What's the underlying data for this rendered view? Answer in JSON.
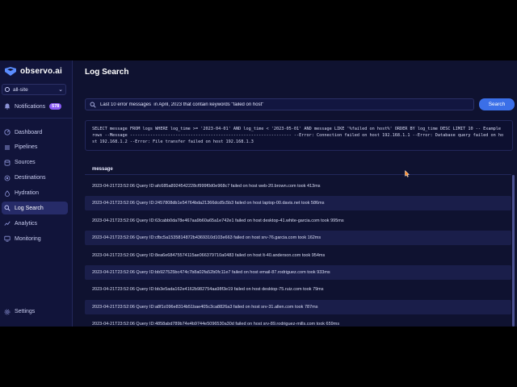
{
  "app": {
    "name": "observo.ai"
  },
  "site_selector": {
    "value": "all-site"
  },
  "notifications": {
    "label": "Notifications",
    "count": "578"
  },
  "nav": {
    "items": [
      {
        "label": "Dashboard",
        "icon": "dashboard-icon"
      },
      {
        "label": "Pipelines",
        "icon": "pipelines-icon"
      },
      {
        "label": "Sources",
        "icon": "sources-icon"
      },
      {
        "label": "Destinations",
        "icon": "destinations-icon"
      },
      {
        "label": "Hydration",
        "icon": "hydration-icon"
      },
      {
        "label": "Log Search",
        "icon": "search-icon",
        "active": true
      },
      {
        "label": "Analytics",
        "icon": "analytics-icon"
      },
      {
        "label": "Monitoring",
        "icon": "monitoring-icon"
      }
    ],
    "settings_label": "Settings"
  },
  "page": {
    "title": "Log Search"
  },
  "search": {
    "value": "Last 10 error messages  in April, 2023 that contain keywords \"failed on host\"",
    "button_label": "Search"
  },
  "query_text": "SELECT message FROM logs WHERE log_time >= '2023-04-01' AND log_time < '2023-05-01' AND message LIKE '%failed on host%' ORDER BY log_time DESC LIMIT 10 -- Example rows --Message ---------------------------------------------------------------- --Error: Connection failed on host 192.168.1.1 --Error: Database query failed on host 192.168.1.2 --Error: File transfer failed on host 192.168.1.3",
  "table": {
    "column": "message",
    "rows": [
      "2023-04-21T23:52:06 Query ID:afc685a8924542228cf999f0d0e968c7 failed on host web-20.brown.com took 413ms",
      "2023-04-21T23:52:06 Query ID:2457808db1e54764bda21366dcd5c5b3 failed on host laptop-00.davis.net took 586ms",
      "2023-04-21T23:52:06 Query ID:63cabb0da78e467aa9b60a65a1e742e1 failed on host desktop-41.white-garcia.com took 995ms",
      "2023-04-21T23:52:06 Query ID:cfbc5a1535814872b4369310d103e663 failed on host srv-76.garcia.com took 162ms",
      "2023-04-21T23:52:06 Query ID:8ea6e68475574115ae066379710a0483 failed on host lt-40.anderson.com took 954ms",
      "2023-04-21T23:52:06 Query ID:bb927525bc474c7b8a02fa52b0fc11e7 failed on host email-87.rodriguez.com took 933ms",
      "2023-04-21T23:52:06 Query ID:bb3e5ada162e4162b982754aa98f3e19 failed on host desktop-75.ruiz.com took 79ms",
      "2023-04-21T23:52:06 Query ID:a8f1c096e8314b51bae405c3ca8826a3 failed on host srv-31.allen.com took 787ms",
      "2023-04-21T23:52:06 Query ID:4858abd789b74e4b9744e5096530a30d failed on host srv-89.rodriguez-mills.com took 659ms"
    ]
  },
  "colors": {
    "accent": "#3b6fe8",
    "badge": "#8b5cf6",
    "background": "#0f1230",
    "sidebar": "#11143a"
  }
}
